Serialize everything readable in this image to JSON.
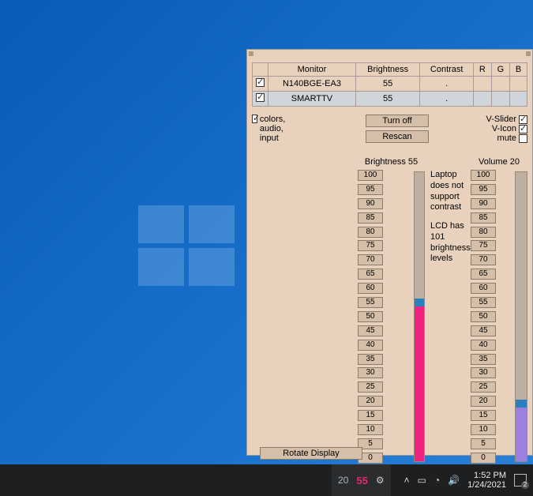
{
  "table": {
    "headers": {
      "monitor": "Monitor",
      "brightness": "Brightness",
      "contrast": "Contrast",
      "r": "R",
      "g": "G",
      "b": "B"
    },
    "rows": [
      {
        "checked": true,
        "name": "N140BGE-EA3",
        "brightness": "55",
        "contrast": ".",
        "r": "",
        "g": "",
        "b": "",
        "selected": false
      },
      {
        "checked": true,
        "name": "SMARTTV",
        "brightness": "55",
        "contrast": ".",
        "r": "",
        "g": "",
        "b": "",
        "selected": true
      }
    ]
  },
  "options": {
    "colors_audio_input": {
      "label": "colors, audio, input",
      "checked": true
    },
    "vslider": {
      "label": "V-Slider",
      "checked": true
    },
    "vicon": {
      "label": "V-Icon",
      "checked": true
    },
    "mute": {
      "label": "mute",
      "checked": false
    }
  },
  "buttons": {
    "turnoff": "Turn off",
    "rescan": "Rescan",
    "rotate": "Rotate Display"
  },
  "brightness": {
    "label": "Brightness 55",
    "value": 55,
    "max": 100,
    "fill_color": "#ed247f",
    "steps": [
      100,
      95,
      90,
      85,
      80,
      75,
      70,
      65,
      60,
      55,
      50,
      45,
      40,
      35,
      30,
      25,
      20,
      15,
      10,
      5,
      0
    ]
  },
  "volume": {
    "label": "Volume 20",
    "value": 20,
    "max": 100,
    "fill_color": "#9b80e2",
    "steps": [
      100,
      95,
      90,
      85,
      80,
      75,
      70,
      65,
      60,
      55,
      50,
      45,
      40,
      35,
      30,
      25,
      20,
      15,
      10,
      5,
      0
    ]
  },
  "notes": {
    "line1": "Laptop does not support contrast",
    "line2": "LCD has 101 brightness levels"
  },
  "taskbar": {
    "tray_vol": "20",
    "tray_bright": "55",
    "time": "1:52 PM",
    "date": "1/24/2021",
    "notif_count": "2"
  }
}
